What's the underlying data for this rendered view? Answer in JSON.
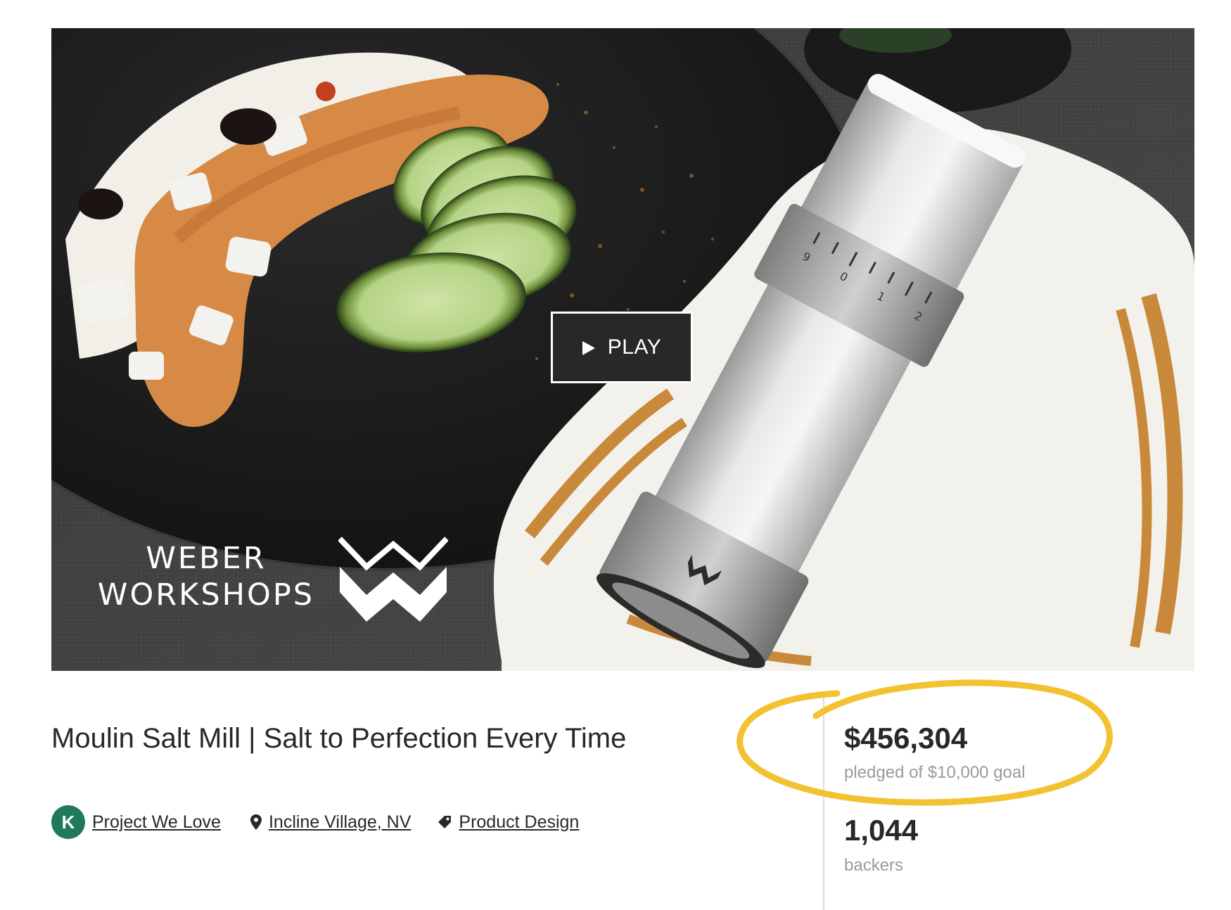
{
  "hero": {
    "play_label": "PLAY",
    "brand_line1": "WEBER",
    "brand_line2": "WORKSHOPS",
    "brand_logo": "weber-workshops-w-logo",
    "icons": {
      "play": "play-triangle-icon"
    },
    "grinder_dial_numbers": [
      "9",
      "0",
      "1",
      "2"
    ]
  },
  "project": {
    "title": "Moulin Salt Mill | Salt to Perfection Every Time",
    "badges": {
      "project_we_love": "Project We Love",
      "location": "Incline Village, NV",
      "category": "Product Design"
    },
    "icons": {
      "project_we_love": "kickstarter-k-badge-icon",
      "location": "map-pin-icon",
      "category": "tag-icon"
    }
  },
  "stats": {
    "pledged_amount": "$456,304",
    "pledged_label": "pledged of $10,000 goal",
    "backers_count": "1,044",
    "backers_label": "backers"
  },
  "colors": {
    "highlight": "#f2c230",
    "pwl_badge": "#1f7a5c",
    "text": "#282828",
    "muted": "#9a9a9a"
  }
}
